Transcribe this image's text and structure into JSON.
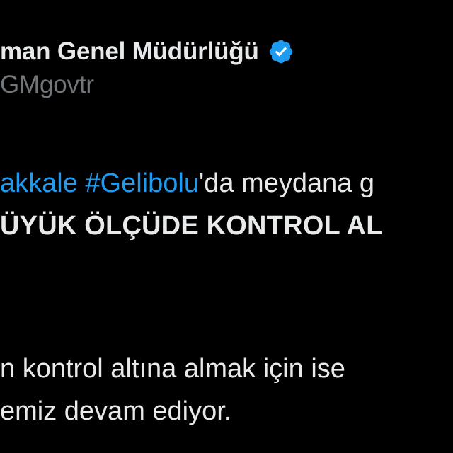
{
  "tweet": {
    "author": {
      "display_name": "man Genel Müdürlüğü",
      "handle": "GMgovtr",
      "verified_badge_icon": "verified-badge-icon",
      "verified_color": "#1d9bf0"
    },
    "body": {
      "line1": {
        "hashtag_1": "akkale",
        "space": " ",
        "hashtag_2": "#Gelibolu",
        "rest": "'da meydana g"
      },
      "line2": "ÜYÜK ÖLÇÜDE KONTROL AL",
      "line3": "n kontrol altına almak için ise",
      "line4": "emiz devam ediyor."
    }
  },
  "colors": {
    "background": "#000000",
    "text_primary": "#e7e9ea",
    "text_secondary": "#71767b",
    "link": "#1d9bf0"
  }
}
